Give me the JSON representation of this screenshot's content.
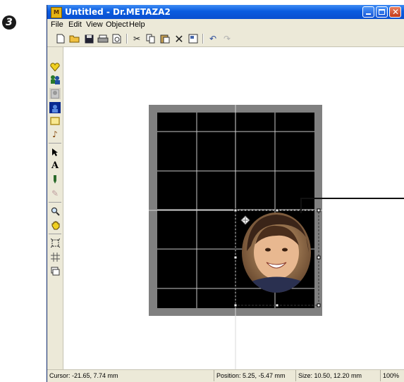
{
  "step_marker": "3",
  "window": {
    "title": "Untitled - Dr.METAZA2",
    "app_icon": "M"
  },
  "menu": [
    "File",
    "Edit",
    "View",
    "Object",
    "Help"
  ],
  "toolbar_icons": [
    "new-file-icon",
    "open-folder-icon",
    "save-icon",
    "print-icon",
    "print-preview-icon",
    "cut-icon",
    "copy-icon",
    "paste-icon",
    "delete-icon",
    "properties-icon",
    "undo-icon",
    "redo-icon"
  ],
  "tools": [
    "heart-shape-icon",
    "people-icon",
    "portrait-icon",
    "portrait-selected-icon",
    "rectangle-icon",
    "music-note-icon",
    "select-arrow-icon",
    "text-tool-icon",
    "pen-icon",
    "eyedropper-icon",
    "zoom-icon",
    "hand-icon",
    "fit-icon",
    "grid-icon",
    "layers-icon"
  ],
  "status": {
    "cursor": "Cursor: -21.65, 7.74 mm",
    "position": "Position: 5.25, -5.47 mm",
    "size": "Size: 10.50, 12.20 mm",
    "zoom": "100%"
  },
  "colors": {
    "title_bar": "#0a5ce0",
    "canvas_frame": "#808080",
    "canvas_fill": "#000000",
    "grid_line": "#c8c8c8"
  }
}
